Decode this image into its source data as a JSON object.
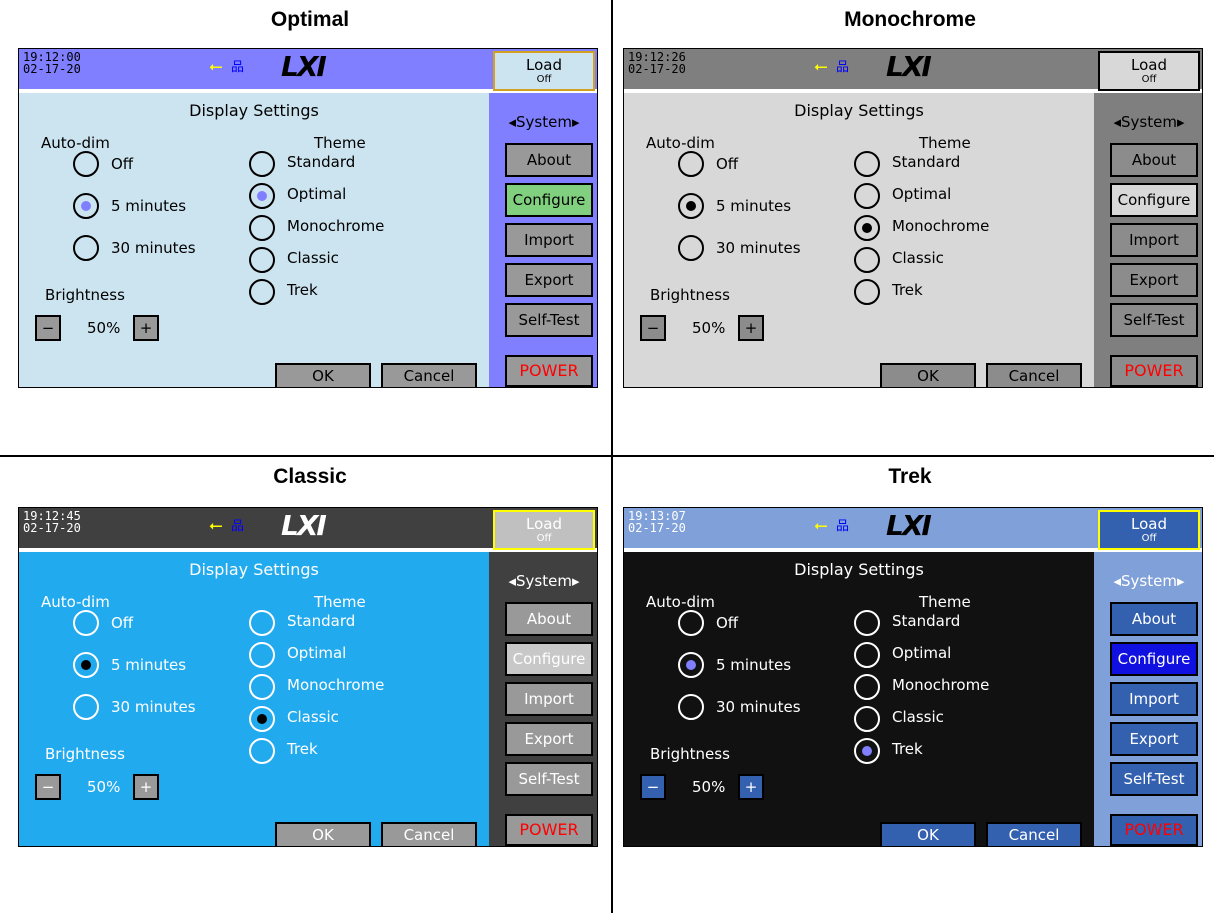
{
  "panels": [
    {
      "heading": "Optimal",
      "clock": {
        "time": "19:12:00",
        "date": "02-17-20"
      },
      "colors": {
        "topbar": "#7f7fff",
        "text": "#000000",
        "content": "#cce4f0",
        "side": "#7f7fff",
        "btn": "#999999",
        "active_btn": "#80d080",
        "load_bg": "#cce4f0",
        "load_border": "#d4a020",
        "radio": "#000000",
        "dot": "#7f7fff",
        "ok_btn": "#999999"
      },
      "load": {
        "label": "Load",
        "sub": "Off"
      },
      "logo": "LXI",
      "usb_icon": "usb-icon",
      "network_icon": "network-icon",
      "title": "Display Settings",
      "autodim": {
        "label": "Auto-dim",
        "options": [
          "Off",
          "5 minutes",
          "30 minutes"
        ],
        "selected": 1
      },
      "theme": {
        "label": "Theme",
        "options": [
          "Standard",
          "Optimal",
          "Monochrome",
          "Classic",
          "Trek"
        ],
        "selected": 1
      },
      "brightness": {
        "label": "Brightness",
        "minus": "−",
        "plus": "+",
        "value": "50%"
      },
      "ok": "OK",
      "cancel": "Cancel",
      "system": "◂System▸",
      "menu": [
        "About",
        "Configure",
        "Import",
        "Export",
        "Self-Test"
      ],
      "menu_active": 1,
      "power": "POWER"
    },
    {
      "heading": "Monochrome",
      "clock": {
        "time": "19:12:26",
        "date": "02-17-20"
      },
      "colors": {
        "topbar": "#7f7f7f",
        "text": "#000000",
        "content": "#d8d8d8",
        "side": "#7f7f7f",
        "btn": "#8c8c8c",
        "active_btn": "#d8d8d8",
        "load_bg": "#d8d8d8",
        "load_border": "#000000",
        "radio": "#000000",
        "dot": "#000000",
        "ok_btn": "#8c8c8c"
      },
      "load": {
        "label": "Load",
        "sub": "Off"
      },
      "logo": "LXI",
      "usb_icon": "usb-icon",
      "network_icon": "network-icon",
      "title": "Display Settings",
      "autodim": {
        "label": "Auto-dim",
        "options": [
          "Off",
          "5 minutes",
          "30 minutes"
        ],
        "selected": 1
      },
      "theme": {
        "label": "Theme",
        "options": [
          "Standard",
          "Optimal",
          "Monochrome",
          "Classic",
          "Trek"
        ],
        "selected": 2
      },
      "brightness": {
        "label": "Brightness",
        "minus": "−",
        "plus": "+",
        "value": "50%"
      },
      "ok": "OK",
      "cancel": "Cancel",
      "system": "◂System▸",
      "menu": [
        "About",
        "Configure",
        "Import",
        "Export",
        "Self-Test"
      ],
      "menu_active": 1,
      "power": "POWER"
    },
    {
      "heading": "Classic",
      "clock": {
        "time": "19:12:45",
        "date": "02-17-20"
      },
      "colors": {
        "topbar": "#404040",
        "text": "#ffffff",
        "content": "#22aaee",
        "side": "#404040",
        "btn": "#999999",
        "active_btn": "#c8c8c8",
        "load_bg": "#c0c0c0",
        "load_border": "#ffff00",
        "radio": "#ffffff",
        "dot": "#000000",
        "ok_btn": "#999999"
      },
      "load": {
        "label": "Load",
        "sub": "Off"
      },
      "logo": "LXI",
      "usb_icon": "usb-icon",
      "network_icon": "network-icon",
      "title": "Display Settings",
      "autodim": {
        "label": "Auto-dim",
        "options": [
          "Off",
          "5 minutes",
          "30 minutes"
        ],
        "selected": 1
      },
      "theme": {
        "label": "Theme",
        "options": [
          "Standard",
          "Optimal",
          "Monochrome",
          "Classic",
          "Trek"
        ],
        "selected": 3
      },
      "brightness": {
        "label": "Brightness",
        "minus": "−",
        "plus": "+",
        "value": "50%"
      },
      "ok": "OK",
      "cancel": "Cancel",
      "system": "◂System▸",
      "menu": [
        "About",
        "Configure",
        "Import",
        "Export",
        "Self-Test"
      ],
      "menu_active": 1,
      "power": "POWER"
    },
    {
      "heading": "Trek",
      "clock": {
        "time": "19:13:07",
        "date": "02-17-20"
      },
      "colors": {
        "topbar": "#7fa0d8",
        "text": "#ffffff",
        "content": "#111111",
        "side": "#7fa0d8",
        "btn": "#3460b0",
        "active_btn": "#1010e0",
        "load_bg": "#3460b0",
        "load_border": "#ffff00",
        "radio": "#ffffff",
        "dot": "#7f7fff",
        "ok_btn": "#3460b0"
      },
      "load": {
        "label": "Load",
        "sub": "Off"
      },
      "logo": "LXI",
      "usb_icon": "usb-icon",
      "network_icon": "network-icon",
      "title": "Display Settings",
      "autodim": {
        "label": "Auto-dim",
        "options": [
          "Off",
          "5 minutes",
          "30 minutes"
        ],
        "selected": 1
      },
      "theme": {
        "label": "Theme",
        "options": [
          "Standard",
          "Optimal",
          "Monochrome",
          "Classic",
          "Trek"
        ],
        "selected": 4
      },
      "brightness": {
        "label": "Brightness",
        "minus": "−",
        "plus": "+",
        "value": "50%"
      },
      "ok": "OK",
      "cancel": "Cancel",
      "system": "◂System▸",
      "menu": [
        "About",
        "Configure",
        "Import",
        "Export",
        "Self-Test"
      ],
      "menu_active": 1,
      "power": "POWER"
    }
  ]
}
